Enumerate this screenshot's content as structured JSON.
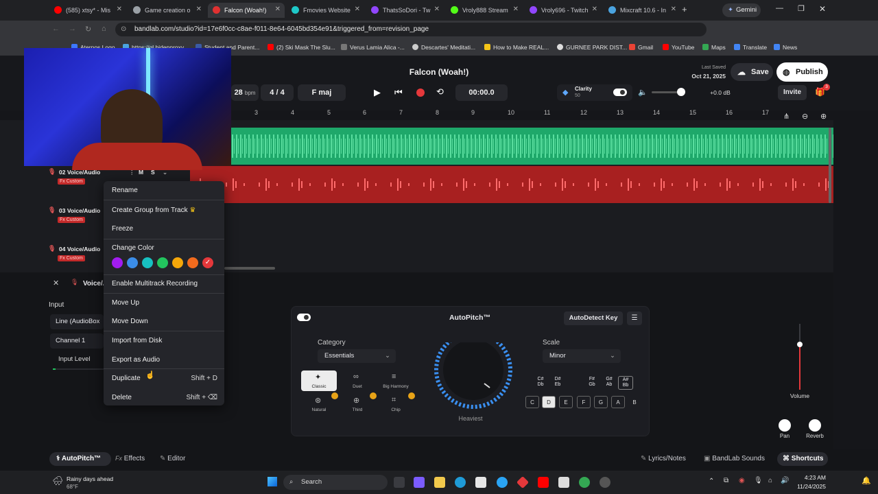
{
  "browser": {
    "tabs": [
      {
        "label": "(585) xtsy* - Mis",
        "color": "#ff0000"
      },
      {
        "label": "Game creation o",
        "color": "#9aa0a6"
      },
      {
        "label": "Falcon (Woah!)",
        "color": "#e03131"
      },
      {
        "label": "Fmovies Website",
        "color": "#1ec8c8"
      },
      {
        "label": "ThatsSoDori - Tw",
        "color": "#9146ff"
      },
      {
        "label": "Vroly888 Stream",
        "color": "#53fc18"
      },
      {
        "label": "Vroly696 - Twitch",
        "color": "#9146ff"
      },
      {
        "label": "Mixcraft 10.6 - In",
        "color": "#4aa3df"
      }
    ],
    "gemini_label": "Gemini",
    "url": "bandlab.com/studio?id=17e6f0cc-c8ae-f011-8e64-6045bd354e91&triggered_from=revision_page",
    "bookmarks": [
      "Aternos Logo",
      "https://gl.bidenproxy...",
      "Student and Parent...",
      "(2) Ski Mask The Slu...",
      "Verus Lamia Alica -...",
      "Descartes' Meditati...",
      "How to Make REAL...",
      "GURNEE PARK DIST...",
      "Gmail",
      "YouTube",
      "Maps",
      "Translate",
      "News"
    ]
  },
  "studio": {
    "project_title": "Falcon (Woah!)",
    "last_saved_label": "Last Saved",
    "last_saved_date": "Oct 21, 2025",
    "save_label": "Save",
    "publish_label": "Publish",
    "invite_label": "Invite",
    "gift_badge": "3",
    "bpm_value": "28",
    "bpm_unit": "bpm",
    "time_signature": "4 / 4",
    "key": "F maj",
    "time": "00:00.0",
    "clarity_label": "Clarity",
    "clarity_value": "50",
    "volume_db": "+0.0 dB",
    "ruler": [
      "3",
      "4",
      "5",
      "6",
      "7",
      "8",
      "9",
      "10",
      "11",
      "12",
      "13",
      "14",
      "15",
      "16",
      "17"
    ]
  },
  "tracks": [
    {
      "name": "02 Voice/Audio",
      "fx": "Fx Custom",
      "mute": "M",
      "solo": "S"
    },
    {
      "name": "03 Voice/Audio",
      "fx": "Fx Custom"
    },
    {
      "name": "04 Voice/Audio",
      "fx": "Fx Custom"
    }
  ],
  "context_menu": {
    "items": [
      "Rename",
      "Create Group from Track",
      "Freeze",
      "Change Color",
      "Enable Multitrack Recording",
      "Move Up",
      "Move Down",
      "Import from Disk",
      "Export as Audio",
      "Duplicate",
      "Delete"
    ],
    "duplicate_shortcut": "Shift + D",
    "delete_shortcut": "Shift + ⌫",
    "colors": [
      "#a21cf0",
      "#3b8de8",
      "#17c1c1",
      "#22c55e",
      "#f5a70a",
      "#f26b1d",
      "#e5383b"
    ]
  },
  "panel": {
    "track_label": "Voice/A",
    "input_label": "Input",
    "input_device": "Line (AudioBox",
    "channel": "Channel 1",
    "input_level_label": "Input Level",
    "autopitch_title": "AutoPitch™",
    "autodetect_label": "AutoDetect Key",
    "category_label": "Category",
    "category_value": "Essentials",
    "categories": [
      "Classic",
      "Duet",
      "Big Harmony",
      "Natural",
      "Third",
      "Chip"
    ],
    "knob_label": "Heaviest",
    "scale_label": "Scale",
    "scale_value": "Minor",
    "sharps": [
      "C#\nDb",
      "D#\nEb",
      "F#\nGb",
      "G#\nAb",
      "A#\nBb"
    ],
    "keys": [
      "C",
      "D",
      "E",
      "F",
      "G",
      "A",
      "B"
    ],
    "volume_label": "Volume",
    "pan_label": "Pan",
    "reverb_label": "Reverb"
  },
  "footer": {
    "autopitch_tab": "AutoPitch™",
    "effects_tab": "Effects",
    "editor_tab": "Editor",
    "lyrics": "Lyrics/Notes",
    "sounds": "BandLab Sounds",
    "shortcuts": "Shortcuts"
  },
  "taskbar": {
    "weather_title": "Rainy days ahead",
    "weather_temp": "68°F",
    "search_label": "Search",
    "time": "4:23 AM",
    "date": "11/24/2025"
  }
}
